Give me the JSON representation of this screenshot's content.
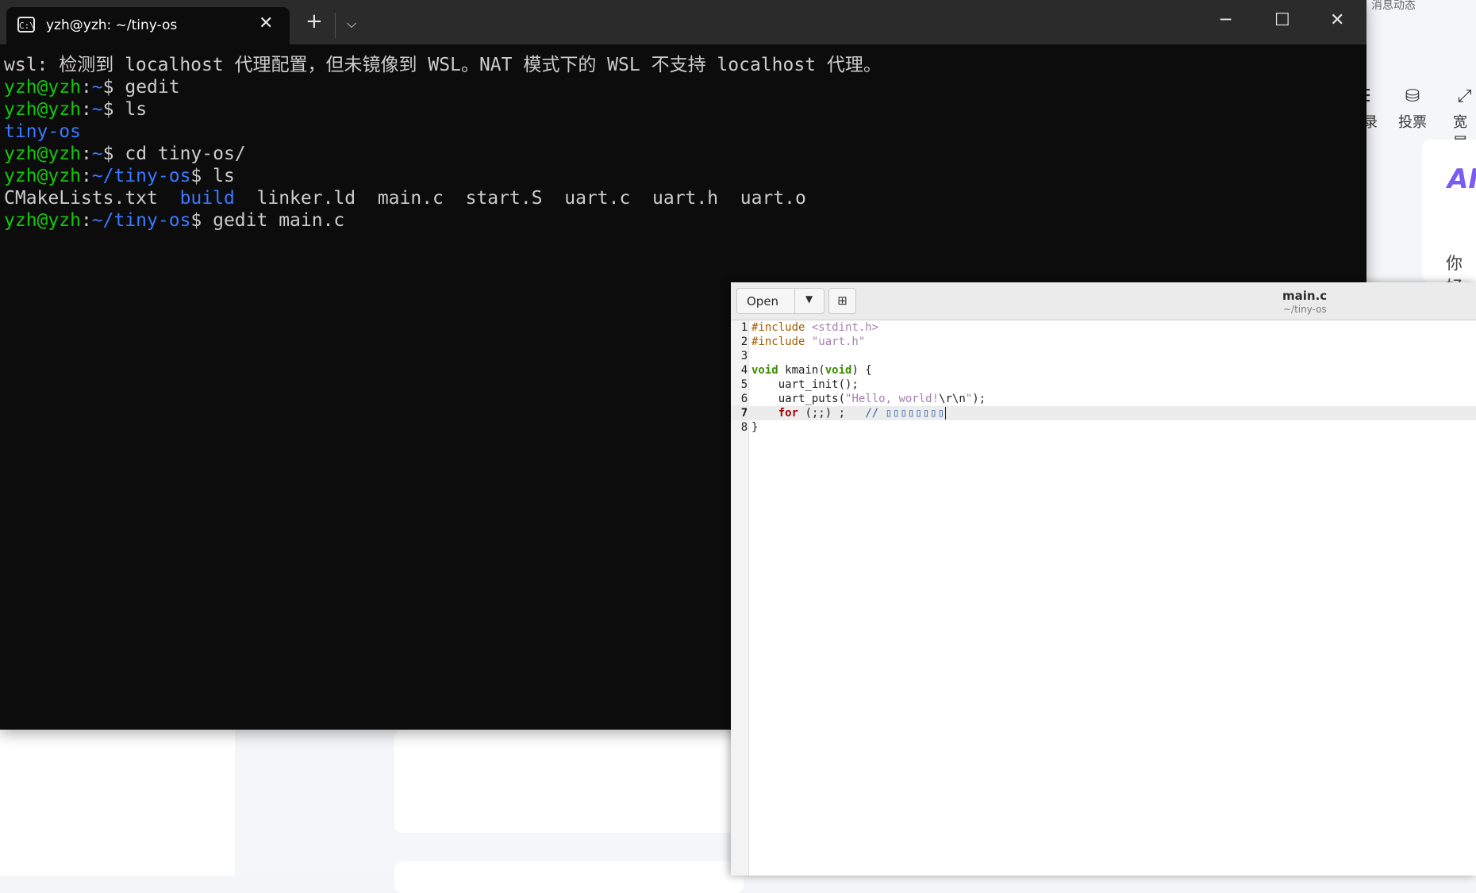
{
  "background_browser": {
    "top_text": "消息动态",
    "toolbar": [
      {
        "label": "目录",
        "icon": "list-icon"
      },
      {
        "label": "投票",
        "icon": "vote-icon"
      },
      {
        "label": "宽屏",
        "icon": "expand-icon"
      }
    ],
    "logo": "AI",
    "greeting": "你好"
  },
  "terminal": {
    "tab_title": "yzh@yzh: ~/tiny-os",
    "new_tab": "+",
    "lines": [
      {
        "segments": [
          {
            "text": "wsl: 检测到 localhost 代理配置，但未镜像到 WSL。NAT 模式下的 WSL 不支持 localhost 代理。",
            "color": "white"
          }
        ]
      },
      {
        "segments": [
          {
            "text": "yzh@yzh",
            "color": "green"
          },
          {
            "text": ":",
            "color": "white"
          },
          {
            "text": "~",
            "color": "blue"
          },
          {
            "text": "$ gedit",
            "color": "white"
          }
        ]
      },
      {
        "segments": [
          {
            "text": "yzh@yzh",
            "color": "green"
          },
          {
            "text": ":",
            "color": "white"
          },
          {
            "text": "~",
            "color": "blue"
          },
          {
            "text": "$ ls",
            "color": "white"
          }
        ]
      },
      {
        "segments": [
          {
            "text": "tiny-os",
            "color": "blue"
          }
        ]
      },
      {
        "segments": [
          {
            "text": "yzh@yzh",
            "color": "green"
          },
          {
            "text": ":",
            "color": "white"
          },
          {
            "text": "~",
            "color": "blue"
          },
          {
            "text": "$ cd tiny-os/",
            "color": "white"
          }
        ]
      },
      {
        "segments": [
          {
            "text": "yzh@yzh",
            "color": "green"
          },
          {
            "text": ":",
            "color": "white"
          },
          {
            "text": "~/tiny-os",
            "color": "blue"
          },
          {
            "text": "$ ls",
            "color": "white"
          }
        ]
      },
      {
        "segments": [
          {
            "text": "CMakeLists.txt  ",
            "color": "white"
          },
          {
            "text": "build",
            "color": "blue"
          },
          {
            "text": "  linker.ld  main.c  start.S  uart.c  uart.h  uart.o",
            "color": "white"
          }
        ]
      },
      {
        "segments": [
          {
            "text": "yzh@yzh",
            "color": "green"
          },
          {
            "text": ":",
            "color": "white"
          },
          {
            "text": "~/tiny-os",
            "color": "blue"
          },
          {
            "text": "$ gedit main.c",
            "color": "white"
          }
        ]
      }
    ]
  },
  "gedit": {
    "open_label": "Open",
    "title": "main.c",
    "subtitle": "~/tiny-os",
    "current_line": 7,
    "code_lines": [
      {
        "n": "1",
        "tokens": [
          {
            "t": "#include ",
            "c": "pp"
          },
          {
            "t": "<stdint.h>",
            "c": "str"
          }
        ]
      },
      {
        "n": "2",
        "tokens": [
          {
            "t": "#include ",
            "c": "pp"
          },
          {
            "t": "\"uart.h\"",
            "c": "str"
          }
        ]
      },
      {
        "n": "3",
        "tokens": []
      },
      {
        "n": "4",
        "tokens": [
          {
            "t": "void",
            "c": "kw"
          },
          {
            "t": " kmain(",
            "c": ""
          },
          {
            "t": "void",
            "c": "kw"
          },
          {
            "t": ") {",
            "c": ""
          }
        ]
      },
      {
        "n": "5",
        "tokens": [
          {
            "t": "    uart_init();",
            "c": ""
          }
        ]
      },
      {
        "n": "6",
        "tokens": [
          {
            "t": "    uart_puts(",
            "c": ""
          },
          {
            "t": "\"Hello, world!",
            "c": "str"
          },
          {
            "t": "\\r\\n",
            "c": "esc"
          },
          {
            "t": "\"",
            "c": "str"
          },
          {
            "t": ");",
            "c": ""
          }
        ]
      },
      {
        "n": "7",
        "tokens": [
          {
            "t": "    ",
            "c": ""
          },
          {
            "t": "for",
            "c": "kw-red"
          },
          {
            "t": " (;;) ;   ",
            "c": ""
          },
          {
            "t": "// ",
            "c": "cm"
          },
          {
            "t": "▯▯▯▯▯▯▯▯",
            "c": "boxes"
          }
        ]
      },
      {
        "n": "8",
        "tokens": [
          {
            "t": "}",
            "c": ""
          }
        ]
      }
    ]
  }
}
